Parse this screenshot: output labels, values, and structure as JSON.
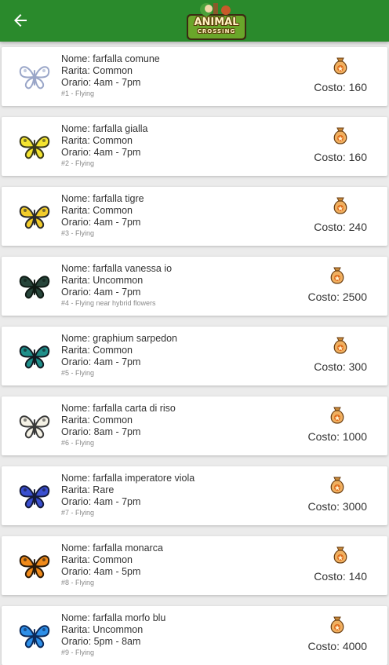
{
  "header": {
    "logo_top": "ANIMAL",
    "logo_bottom": "CROSSING",
    "colors": {
      "bar": "#2a8a2c"
    }
  },
  "items": [
    {
      "name": "Nome: farfalla comune",
      "rarity": "Rarita: Common",
      "hours": "Orario: 4am - 7pm",
      "sub": "#1 - Flying",
      "price": "Costo: 160",
      "colors": [
        "#ffffff",
        "#9aa6c8"
      ]
    },
    {
      "name": "Nome: farfalla gialla",
      "rarity": "Rarita: Common",
      "hours": "Orario: 4am - 7pm",
      "sub": "#2 - Flying",
      "price": "Costo: 160",
      "colors": [
        "#f4e430",
        "#3a3a1a"
      ]
    },
    {
      "name": "Nome: farfalla tigre",
      "rarity": "Rarita: Common",
      "hours": "Orario: 4am - 7pm",
      "sub": "#3 - Flying",
      "price": "Costo: 240",
      "colors": [
        "#f2cc2a",
        "#2a2a2a"
      ]
    },
    {
      "name": "Nome: farfalla vanessa io",
      "rarity": "Rarita: Uncommon",
      "hours": "Orario: 4am - 7pm",
      "sub": "#4 - Flying near hybrid flowers",
      "price": "Costo: 2500",
      "colors": [
        "#27453a",
        "#0e1a14"
      ]
    },
    {
      "name": "Nome: graphium sarpedon",
      "rarity": "Rarita: Common",
      "hours": "Orario: 4am - 7pm",
      "sub": "#5 - Flying",
      "price": "Costo: 300",
      "colors": [
        "#1f8f8a",
        "#111a22"
      ]
    },
    {
      "name": "Nome: farfalla carta di riso",
      "rarity": "Rarita: Common",
      "hours": "Orario: 8am - 7pm",
      "sub": "#6 - Flying",
      "price": "Costo: 1000",
      "colors": [
        "#f5f2e6",
        "#3a3a3a"
      ]
    },
    {
      "name": "Nome: farfalla imperatore viola",
      "rarity": "Rarita: Rare",
      "hours": "Orario: 4am - 7pm",
      "sub": "#7 - Flying",
      "price": "Costo: 3000",
      "colors": [
        "#3a4fd0",
        "#141a3a"
      ]
    },
    {
      "name": "Nome: farfalla monarca",
      "rarity": "Rarita: Common",
      "hours": "Orario: 4am - 5pm",
      "sub": "#8 - Flying",
      "price": "Costo: 140",
      "colors": [
        "#f08a1a",
        "#2a1a0a"
      ]
    },
    {
      "name": "Nome: farfalla morfo blu",
      "rarity": "Rarita: Uncommon",
      "hours": "Orario: 5pm - 8am",
      "sub": "#9 - Flying",
      "price": "Costo: 4000",
      "colors": [
        "#2e8fe8",
        "#0c2a5a"
      ]
    }
  ]
}
